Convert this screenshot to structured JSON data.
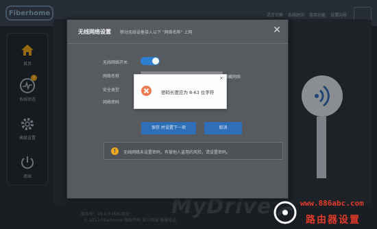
{
  "header": {
    "logo_text": "Fiberhome",
    "links": [
      "语言切换",
      "系统时间",
      "常用功能",
      "设置向导"
    ]
  },
  "sidebar": {
    "items": [
      {
        "label": "首页",
        "icon": "home-icon"
      },
      {
        "label": "系统状态",
        "icon": "status-chart-icon",
        "badge": "!"
      },
      {
        "label": "高级设置",
        "icon": "gear-icon"
      },
      {
        "label": "退出",
        "icon": "power-icon"
      }
    ]
  },
  "background": {
    "brand_watermark": "MyDrive",
    "footer_line1": "版本号：V4.0.0   MAC地址：",
    "footer_line2": "© 2013 FiberHome 版权所有   官方网站   客服电话"
  },
  "watermark": {
    "url": "www.886abc.com",
    "name": "路由器设置"
  },
  "modal": {
    "title": "无线网络设置",
    "subtitle": "移动无线设备接入以下 \"网络名称\" 上网",
    "close_label": "✕",
    "form": {
      "switch_label": "无线网络开关",
      "switch_on": true,
      "ssid_label": "网络名称",
      "ssid_suffix": "隐藏网络",
      "security_label": "安全类型",
      "password_label": "网络密码"
    },
    "save_button": "保存 并设置下一项",
    "cancel_button": "取消",
    "warning_icon": "!",
    "warning_text": "无线网络未设置密码，有被他人盗用的风险，请设置密码。"
  },
  "alert": {
    "close_label": "×",
    "icon": "error-x-icon",
    "message": "密码长度应为 8-63 位字符"
  },
  "colors": {
    "accent": "#2f6fb8",
    "warning": "#f0a91e",
    "error": "#ee7b52",
    "watermark": "#e23b2a"
  }
}
